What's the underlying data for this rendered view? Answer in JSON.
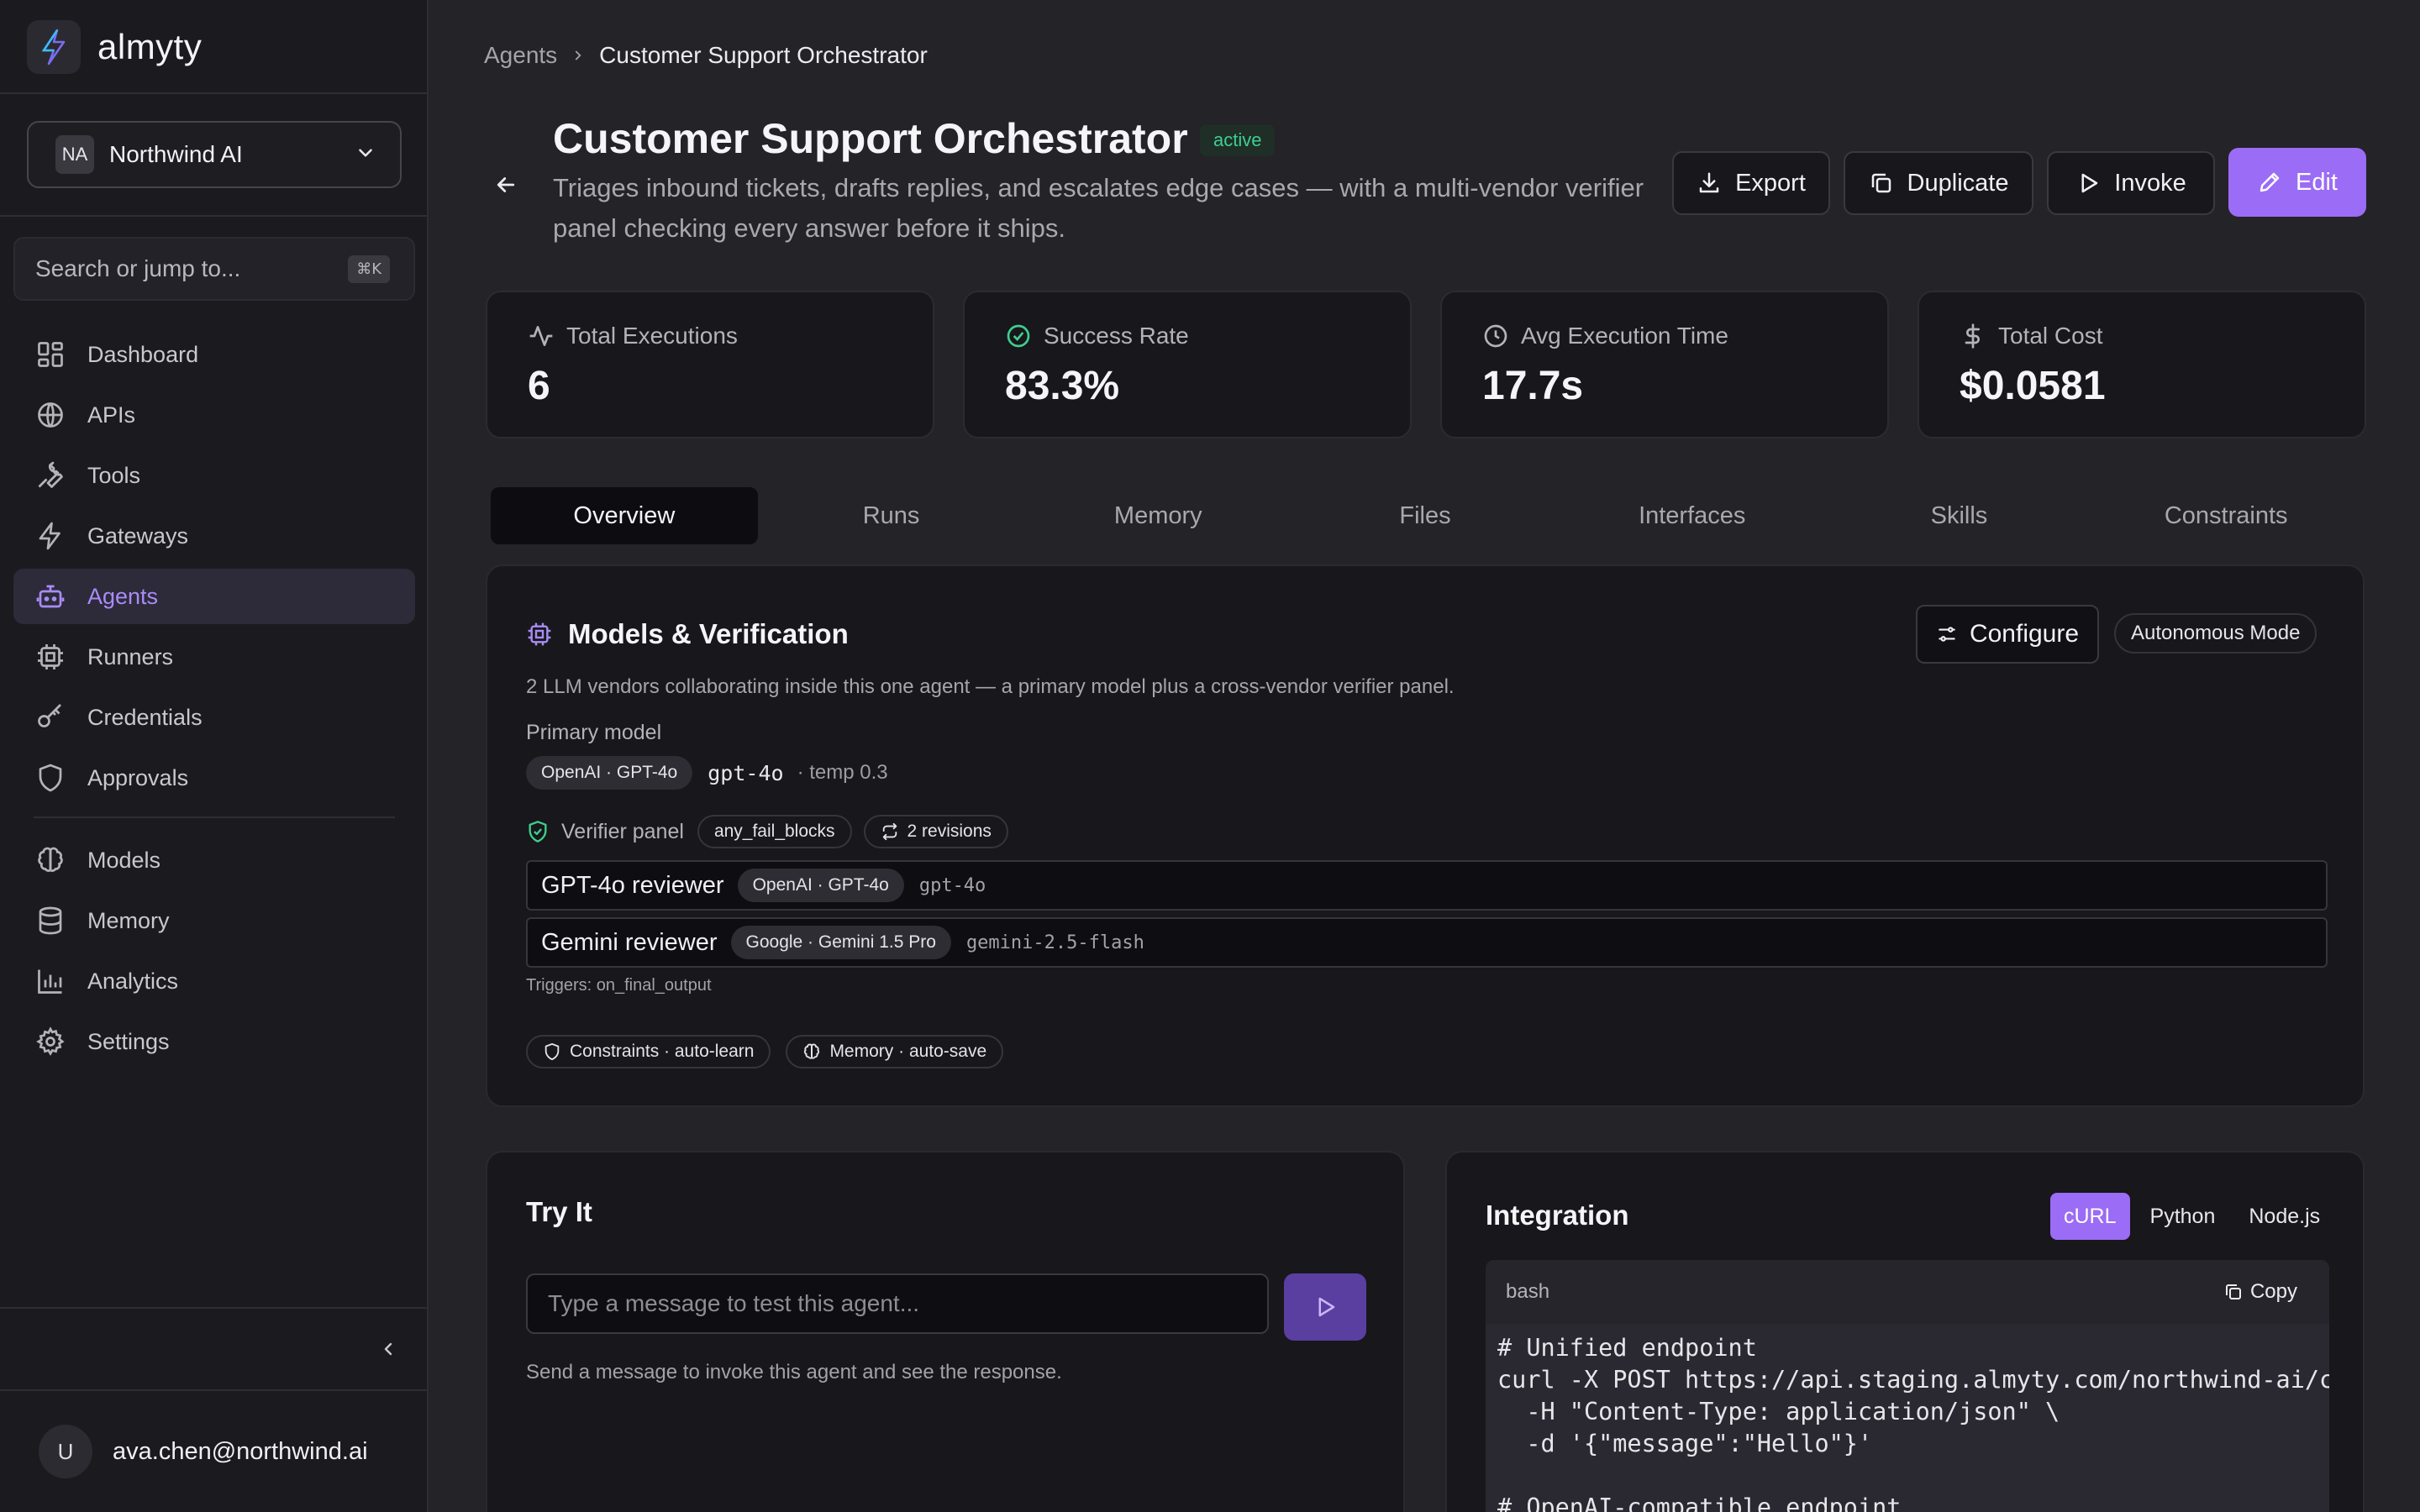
{
  "app": {
    "logo_text": "almyty",
    "org_initials": "NA",
    "org_name": "Northwind AI",
    "search_placeholder": "Search or jump to...",
    "search_shortcut": "⌘K",
    "user_initial": "U",
    "user_email": "ava.chen@northwind.ai"
  },
  "sidebar": {
    "items": [
      {
        "label": "Dashboard",
        "icon": "dashboard-icon"
      },
      {
        "label": "APIs",
        "icon": "globe-icon"
      },
      {
        "label": "Tools",
        "icon": "wrench-icon"
      },
      {
        "label": "Gateways",
        "icon": "lightning-icon"
      },
      {
        "label": "Agents",
        "icon": "bot-icon",
        "active": true
      },
      {
        "label": "Runners",
        "icon": "cpu-icon"
      },
      {
        "label": "Credentials",
        "icon": "key-icon"
      },
      {
        "label": "Approvals",
        "icon": "shield-icon"
      },
      {
        "label": "Models",
        "icon": "brain-icon"
      },
      {
        "label": "Memory",
        "icon": "database-icon"
      },
      {
        "label": "Analytics",
        "icon": "bar-chart-icon"
      },
      {
        "label": "Settings",
        "icon": "gear-icon"
      }
    ]
  },
  "breadcrumb": {
    "parent": "Agents",
    "current": "Customer Support Orchestrator"
  },
  "agent": {
    "title": "Customer Support Orchestrator",
    "status": "active",
    "description": "Triages inbound tickets, drafts replies, and escalates edge cases — with a multi-vendor verifier panel checking every answer before it ships."
  },
  "header_actions": {
    "export": "Export",
    "duplicate": "Duplicate",
    "invoke": "Invoke",
    "edit": "Edit"
  },
  "stats": [
    {
      "label": "Total Executions",
      "value": "6",
      "icon": "activity-icon"
    },
    {
      "label": "Success Rate",
      "value": "83.3%",
      "icon": "check-circle-icon"
    },
    {
      "label": "Avg Execution Time",
      "value": "17.7s",
      "icon": "clock-icon"
    },
    {
      "label": "Total Cost",
      "value": "$0.0581",
      "icon": "dollar-icon"
    }
  ],
  "tabs": [
    "Overview",
    "Runs",
    "Memory",
    "Files",
    "Interfaces",
    "Skills",
    "Constraints"
  ],
  "models_verification": {
    "title": "Models & Verification",
    "configure": "Configure",
    "mode_badge": "Autonomous Mode",
    "subtitle": "2 LLM vendors collaborating inside this one agent — a primary model plus a cross-vendor verifier panel.",
    "primary_label": "Primary model",
    "primary_chip": "OpenAI · GPT-4o",
    "primary_code": "gpt-4o",
    "primary_temp": "· temp 0.3",
    "verifier_label": "Verifier panel",
    "verifier_policy": "any_fail_blocks",
    "verifier_revisions": "2 revisions",
    "reviewers": [
      {
        "name": "GPT-4o reviewer",
        "chip": "OpenAI · GPT-4o",
        "code": "gpt-4o"
      },
      {
        "name": "Gemini reviewer",
        "chip": "Google · Gemini 1.5 Pro",
        "code": "gemini-2.5-flash"
      }
    ],
    "triggers": "Triggers: on_final_output",
    "constraints_chip": "Constraints · auto-learn",
    "memory_chip": "Memory · auto-save"
  },
  "try_it": {
    "title": "Try It",
    "placeholder": "Type a message to test this agent...",
    "help": "Send a message to invoke this agent and see the response."
  },
  "integration": {
    "title": "Integration",
    "tabs": [
      "cURL",
      "Python",
      "Node.js"
    ],
    "active_tab": "cURL",
    "code_lang": "bash",
    "copy": "Copy",
    "code": "# Unified endpoint\ncurl -X POST https://api.staging.almyty.com/northwind-ai/c\n  -H \"Content-Type: application/json\" \\\n  -d '{\"message\":\"Hello\"}'\n\n# OpenAI-compatible endpoint"
  },
  "colors": {
    "accent": "#9b6cf5",
    "active_status": "#3ecf8e",
    "background": "#242328",
    "card": "#18171b"
  }
}
